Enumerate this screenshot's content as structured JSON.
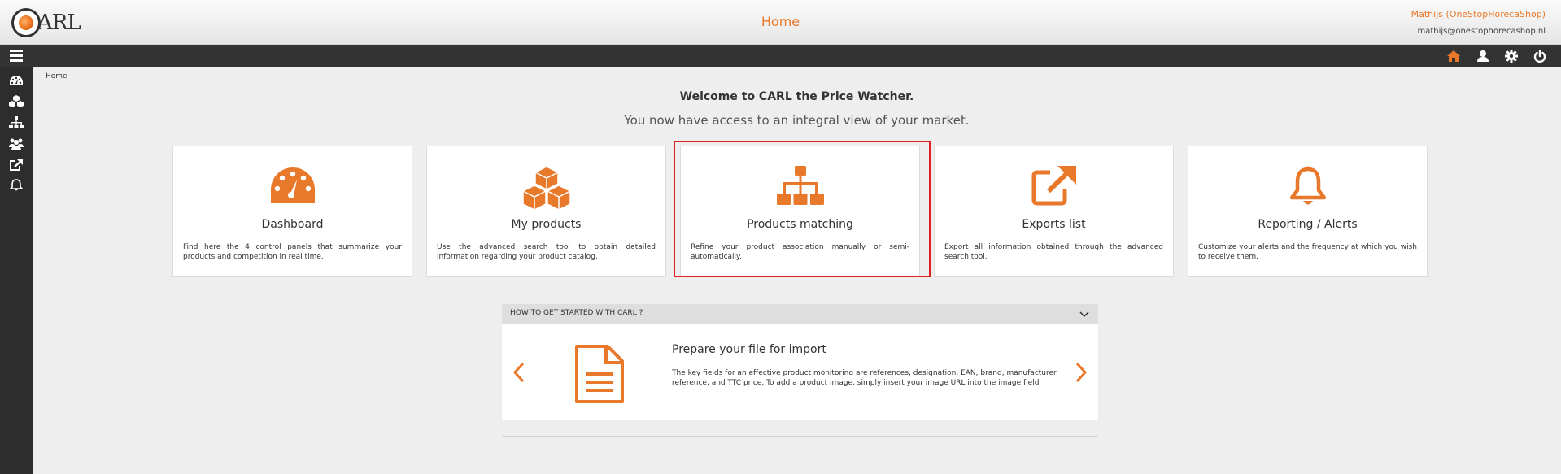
{
  "header": {
    "logo_text": "ARL",
    "title": "Home",
    "user_name": "Mathijs (OneStopHorecaShop)",
    "user_email": "mathijs@onestophorecashop.nl"
  },
  "topbar_icons": [
    "home-icon",
    "user-icon",
    "gear-icon",
    "power-icon"
  ],
  "sidebar": {
    "items": [
      "dashboard-icon",
      "cubes-icon",
      "sitemap-icon",
      "users-icon",
      "external-link-icon",
      "bell-icon"
    ]
  },
  "breadcrumb": "Home",
  "welcome": "Welcome to CARL the Price Watcher.",
  "subtitle": "You now have access to an integral view of your market.",
  "cards": [
    {
      "title": "Dashboard",
      "desc": "Find here the 4 control panels that summarize your products and competition in real time.",
      "icon": "dashboard-icon"
    },
    {
      "title": "My products",
      "desc": "Use the advanced search tool to obtain detailed information regarding your product catalog.",
      "icon": "cubes-icon"
    },
    {
      "title": "Products matching",
      "desc": "Refine your product association manually or semi-automatically.",
      "icon": "sitemap-icon"
    },
    {
      "title": "Exports list",
      "desc": "Export all information obtained through the advanced search tool.",
      "icon": "external-link-icon"
    },
    {
      "title": "Reporting / Alerts",
      "desc": "Customize your alerts and the frequency at which you wish to receive them.",
      "icon": "bell-icon"
    }
  ],
  "getting_started": {
    "header": "HOW TO GET STARTED WITH CARL ?",
    "title": "Prepare your file for import",
    "desc": "The key fields for an effective product monitoring are references, designation, EAN, brand, manufacturer reference, and TTC price. To add a product image, simply insert your image URL into the image field"
  },
  "colors": {
    "accent": "#e8792b",
    "dark_bar": "#333333",
    "sidebar": "#2d2d2d",
    "highlight": "#e02020"
  }
}
